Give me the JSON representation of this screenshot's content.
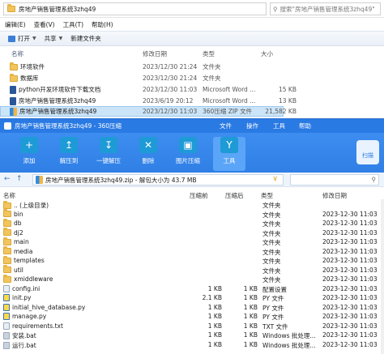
{
  "explorer": {
    "path": "房地产销售管理系统3zhq49",
    "search_placeholder": "搜索\"房地产销售管理系统3zhq49\"",
    "menu": [
      "编辑(E)",
      "查看(V)",
      "工具(T)",
      "帮助(H)"
    ],
    "toolbar": {
      "open": "打开",
      "share": "共享",
      "new_folder": "新建文件夹"
    },
    "headers": {
      "name": "名称",
      "date": "修改日期",
      "type": "类型",
      "size": "大小"
    },
    "rows": [
      {
        "name": "环境软件",
        "date": "2023/12/30 21:24",
        "type": "文件夹",
        "size": "",
        "icon": "folder"
      },
      {
        "name": "数据库",
        "date": "2023/12/30 21:24",
        "type": "文件夹",
        "size": "",
        "icon": "folder"
      },
      {
        "name": "python开发环境软件下载文档",
        "date": "2023/12/30 11:03",
        "type": "Microsoft Word ...",
        "size": "15 KB",
        "icon": "word"
      },
      {
        "name": "房地产销售管理系统3zhq49",
        "date": "2023/6/19 20:12",
        "type": "Microsoft Word ...",
        "size": "13 KB",
        "icon": "word"
      },
      {
        "name": "房地产销售管理系统3zhq49",
        "date": "2023/12/30 11:03",
        "type": "360压缩 ZIP 文件",
        "size": "21,582 KB",
        "icon": "zip"
      }
    ]
  },
  "zip": {
    "title": "房地产销售管理系统3zhq49 - 360压缩",
    "menu": [
      "文件",
      "操作",
      "工具",
      "帮助"
    ],
    "tools": [
      {
        "label": "添加",
        "icon": "plus-icon"
      },
      {
        "label": "解压到",
        "icon": "extract-icon"
      },
      {
        "label": "一键解压",
        "icon": "one-click-extract-icon"
      },
      {
        "label": "删除",
        "icon": "trash-icon"
      },
      {
        "label": "图片压缩",
        "icon": "image-icon"
      },
      {
        "label": "工具",
        "icon": "tools-icon"
      }
    ],
    "scan_label": "扫描",
    "address": "房地产销售管理系统3zhq49.zip - 解包大小为 43.7 MB",
    "headers": {
      "name": "名称",
      "size": "压缩前",
      "packed": "压缩后",
      "type": "类型",
      "date": "修改日期"
    },
    "rows": [
      {
        "name": ".. (上级目录)",
        "size": "",
        "packed": "",
        "type": "文件夹",
        "date": "",
        "icon": "folder"
      },
      {
        "name": "bin",
        "size": "",
        "packed": "",
        "type": "文件夹",
        "date": "2023-12-30 11:03",
        "icon": "folder"
      },
      {
        "name": "db",
        "size": "",
        "packed": "",
        "type": "文件夹",
        "date": "2023-12-30 11:03",
        "icon": "folder"
      },
      {
        "name": "dj2",
        "size": "",
        "packed": "",
        "type": "文件夹",
        "date": "2023-12-30 11:03",
        "icon": "folder"
      },
      {
        "name": "main",
        "size": "",
        "packed": "",
        "type": "文件夹",
        "date": "2023-12-30 11:03",
        "icon": "folder"
      },
      {
        "name": "media",
        "size": "",
        "packed": "",
        "type": "文件夹",
        "date": "2023-12-30 11:03",
        "icon": "folder"
      },
      {
        "name": "templates",
        "size": "",
        "packed": "",
        "type": "文件夹",
        "date": "2023-12-30 11:03",
        "icon": "folder"
      },
      {
        "name": "util",
        "size": "",
        "packed": "",
        "type": "文件夹",
        "date": "2023-12-30 11:03",
        "icon": "folder"
      },
      {
        "name": "xmiddleware",
        "size": "",
        "packed": "",
        "type": "文件夹",
        "date": "2023-12-30 11:03",
        "icon": "folder"
      },
      {
        "name": "config.ini",
        "size": "1 KB",
        "packed": "1 KB",
        "type": "配置设置",
        "date": "2023-12-30 11:03",
        "icon": "file"
      },
      {
        "name": "init.py",
        "size": "2.1 KB",
        "packed": "1 KB",
        "type": "PY 文件",
        "date": "2023-12-30 11:03",
        "icon": "py"
      },
      {
        "name": "initial_hive_database.py",
        "size": "1 KB",
        "packed": "1 KB",
        "type": "PY 文件",
        "date": "2023-12-30 11:03",
        "icon": "py"
      },
      {
        "name": "manage.py",
        "size": "1 KB",
        "packed": "1 KB",
        "type": "PY 文件",
        "date": "2023-12-30 11:03",
        "icon": "py"
      },
      {
        "name": "requirements.txt",
        "size": "1 KB",
        "packed": "1 KB",
        "type": "TXT 文件",
        "date": "2023-12-30 11:03",
        "icon": "file"
      },
      {
        "name": "安装.bat",
        "size": "1 KB",
        "packed": "1 KB",
        "type": "Windows 批处理...",
        "date": "2023-12-30 11:03",
        "icon": "bat"
      },
      {
        "name": "运行.bat",
        "size": "1 KB",
        "packed": "1 KB",
        "type": "Windows 批处理...",
        "date": "2023-12-30 11:03",
        "icon": "bat"
      }
    ]
  }
}
